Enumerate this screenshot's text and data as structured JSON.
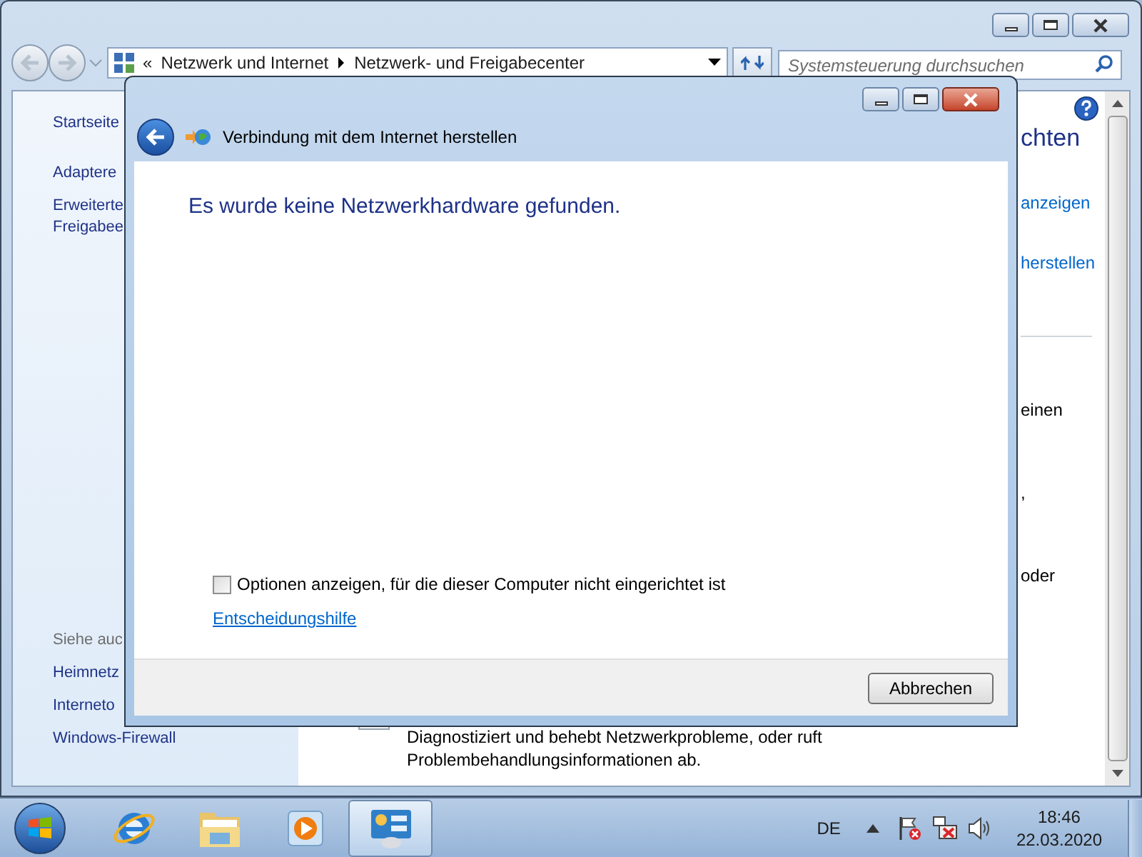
{
  "explorer": {
    "overflow": "«",
    "path": [
      "Netzwerk und Internet",
      "Netzwerk- und Freigabecenter"
    ],
    "search": {
      "placeholder": "Systemsteuerung durchsuchen"
    }
  },
  "sidebar": {
    "items": [
      {
        "lines": [
          "Startseite"
        ],
        "kind": "home"
      },
      {
        "lines": [
          "Adaptere"
        ],
        "kind": "task"
      },
      {
        "lines": [
          "Erweiterte",
          "Freigabee"
        ],
        "kind": "task"
      }
    ],
    "see_also": {
      "heading": "Siehe auc",
      "items": [
        "Heimnetz",
        "Interneto",
        "Windows-Firewall"
      ]
    }
  },
  "content": {
    "fragments": [
      {
        "text": "chten",
        "kind": "heading"
      },
      {
        "text": "anzeigen",
        "kind": "link"
      },
      {
        "text": "herstellen",
        "kind": "link"
      },
      {
        "kind": "divider"
      },
      {
        "text": "einen",
        "kind": "text"
      },
      {
        "text": ",",
        "kind": "text"
      },
      {
        "text": "oder",
        "kind": "text"
      }
    ],
    "description": "Diagnostiziert und behebt Netzwerkprobleme, oder ruft Problembehandlungsinformationen ab."
  },
  "dialog": {
    "title": "Verbindung mit dem Internet herstellen",
    "heading": "Es wurde keine Netzwerkhardware gefunden.",
    "option": {
      "label": "Optionen anzeigen, für die dieser Computer nicht eingerichtet ist",
      "checked": false
    },
    "help_link": "Entscheidungshilfe",
    "cancel": "Abbrechen"
  },
  "taskbar": {
    "apps": [
      {
        "kind": "browser",
        "selected": false
      },
      {
        "kind": "folder",
        "selected": false
      },
      {
        "kind": "media",
        "selected": false
      },
      {
        "kind": "control",
        "selected": true
      }
    ],
    "language": "DE",
    "time": "18:46",
    "date": "22.03.2020"
  }
}
